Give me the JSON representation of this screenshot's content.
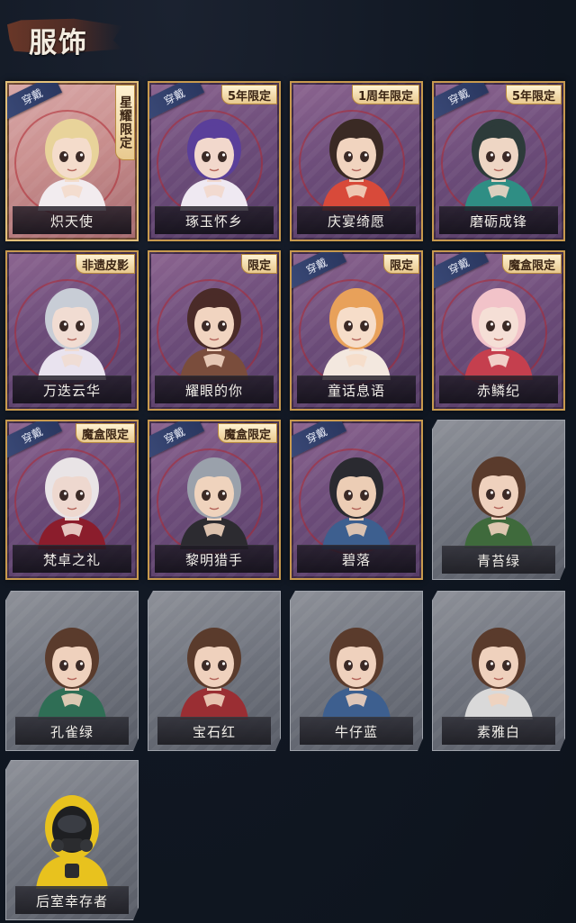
{
  "header": {
    "title": "服饰"
  },
  "labels": {
    "wear": "穿戴"
  },
  "cards": [
    {
      "name": "炽天使",
      "badge": "星耀限定",
      "worn": true,
      "style": "gold",
      "hair": "#e8d39a",
      "skin": "#f4dccb",
      "cloth": "#f2ecef"
    },
    {
      "name": "琢玉怀乡",
      "badge": "5年限定",
      "worn": true,
      "style": "purple",
      "hair": "#5a3f9a",
      "skin": "#f2d8cc",
      "cloth": "#efe9f2"
    },
    {
      "name": "庆宴绮愿",
      "badge": "1周年限定",
      "worn": false,
      "style": "purple",
      "hair": "#3a2a24",
      "skin": "#f1d4bf",
      "cloth": "#d84a3a"
    },
    {
      "name": "磨砺成锋",
      "badge": "5年限定",
      "worn": true,
      "style": "purple",
      "hair": "#2d3b3a",
      "skin": "#eed6c4",
      "cloth": "#2f8e84"
    },
    {
      "name": "万迭云华",
      "badge": "非遗皮影",
      "worn": false,
      "style": "purple",
      "hair": "#c8cdd6",
      "skin": "#f1dcd2",
      "cloth": "#e9e3ef"
    },
    {
      "name": "耀眼的你",
      "badge": "限定",
      "worn": false,
      "style": "purple",
      "hair": "#4a2b28",
      "skin": "#f1d4c0",
      "cloth": "#7a4d3c"
    },
    {
      "name": "童话息语",
      "badge": "限定",
      "worn": true,
      "style": "purple",
      "hair": "#e8a15a",
      "skin": "#f6ddc9",
      "cloth": "#f3e8df"
    },
    {
      "name": "赤鳞纪",
      "badge": "魔盒限定",
      "worn": true,
      "style": "purple",
      "hair": "#f2c3c9",
      "skin": "#f5dfd6",
      "cloth": "#c53f4e"
    },
    {
      "name": "梵卓之礼",
      "badge": "魔盒限定",
      "worn": true,
      "style": "purple",
      "hair": "#e9e4e6",
      "skin": "#eed8cf",
      "cloth": "#8b1d2c"
    },
    {
      "name": "黎明猎手",
      "badge": "魔盒限定",
      "worn": true,
      "style": "purple",
      "hair": "#9aa1ab",
      "skin": "#efd3bd",
      "cloth": "#2c2b30"
    },
    {
      "name": "碧落",
      "badge": "",
      "worn": true,
      "style": "purple",
      "hair": "#2a2a30",
      "skin": "#eccdb5",
      "cloth": "#3d5f8f"
    },
    {
      "name": "青苔绿",
      "badge": "",
      "worn": false,
      "style": "grey",
      "hair": "#5a3b2c",
      "skin": "#efd1bd",
      "cloth": "#3f6a3c"
    },
    {
      "name": "孔雀绿",
      "badge": "",
      "worn": false,
      "style": "grey",
      "hair": "#5a3b2c",
      "skin": "#efd1bd",
      "cloth": "#2f6e55"
    },
    {
      "name": "宝石红",
      "badge": "",
      "worn": false,
      "style": "grey",
      "hair": "#5a3b2c",
      "skin": "#efd1bd",
      "cloth": "#9a2e33"
    },
    {
      "name": "牛仔蓝",
      "badge": "",
      "worn": false,
      "style": "grey",
      "hair": "#5a3b2c",
      "skin": "#efd1bd",
      "cloth": "#3d5f8f"
    },
    {
      "name": "素雅白",
      "badge": "",
      "worn": false,
      "style": "grey",
      "hair": "#5a3b2c",
      "skin": "#efd1bd",
      "cloth": "#d9d9d9"
    },
    {
      "name": "后室幸存者",
      "badge": "",
      "worn": false,
      "style": "grey",
      "hair": "#e8c21e",
      "skin": "#2a2a2a",
      "cloth": "#e8c21e",
      "hazmat": true
    }
  ]
}
